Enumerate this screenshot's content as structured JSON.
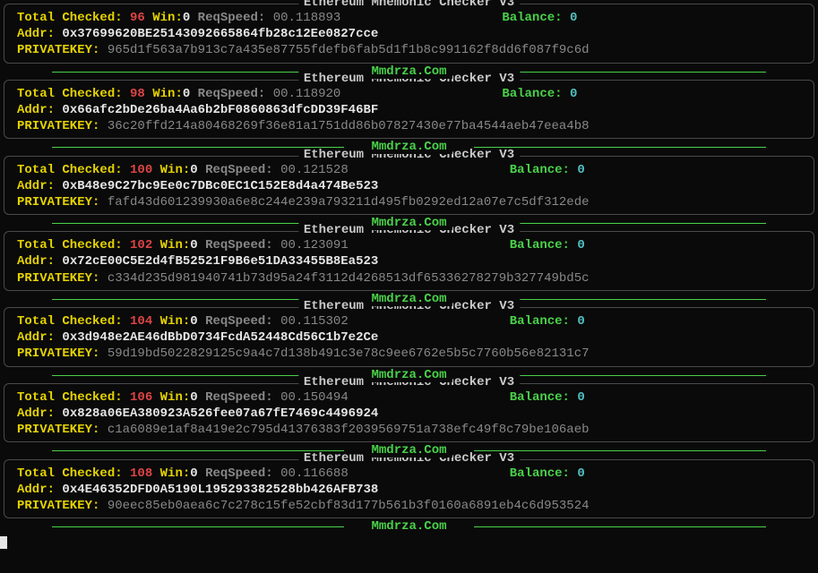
{
  "labels": {
    "title": "Ethereum Mnemonic Checker V3",
    "totalChecked": "Total Checked:",
    "win": "Win:",
    "reqSpeed": "ReqSpeed:",
    "balance": "Balance:",
    "addr": "Addr:",
    "privateKey": "PRIVATEKEY:",
    "footer": "Mmdrza.Com"
  },
  "entries": [
    {
      "totalChecked": "96",
      "win": "0",
      "reqSpeed": "00.118893",
      "balance": "0",
      "addr": "0x37699620BE25143092665864fb28c12Ee0827cce",
      "privateKey": "965d1f563a7b913c7a435e87755fdefb6fab5d1f1b8c991162f8dd6f087f9c6d"
    },
    {
      "totalChecked": "98",
      "win": "0",
      "reqSpeed": "00.118920",
      "balance": "0",
      "addr": "0x66afc2bDe26ba4Aa6b2bF0860863dfcDD39F46BF",
      "privateKey": "36c20ffd214a80468269f36e81a1751dd86b07827430e77ba4544aeb47eea4b8"
    },
    {
      "totalChecked": "100",
      "win": "0",
      "reqSpeed": "00.121528",
      "balance": "0",
      "addr": "0xB48e9C27bc9Ee0c7DBc0EC1C152E8d4a474Be523",
      "privateKey": "fafd43d601239930a6e8c244e239a793211d495fb0292ed12a07e7c5df312ede"
    },
    {
      "totalChecked": "102",
      "win": "0",
      "reqSpeed": "00.123091",
      "balance": "0",
      "addr": "0x72cE00C5E2d4fB52521F9B6e51DA33455B8Ea523",
      "privateKey": "c334d235d981940741b73d95a24f3112d4268513df65336278279b327749bd5c"
    },
    {
      "totalChecked": "104",
      "win": "0",
      "reqSpeed": "00.115302",
      "balance": "0",
      "addr": "0x3d948e2AE46dBbD0734FcdA52448Cd56C1b7e2Ce",
      "privateKey": "59d19bd5022829125c9a4c7d138b491c3e78c9ee6762e5b5c7760b56e82131c7"
    },
    {
      "totalChecked": "106",
      "win": "0",
      "reqSpeed": "00.150494",
      "balance": "0",
      "addr": "0x828a06EA380923A526fee07a67fE7469c4496924",
      "privateKey": "c1a6089e1af8a419e2c795d41376383f2039569751a738efc49f8c79be106aeb"
    },
    {
      "totalChecked": "108",
      "win": "0",
      "reqSpeed": "00.116688",
      "balance": "0",
      "addr": "0x4E46352DFD0A5190L195293382528bb426AFB738",
      "privateKey": "90eec85eb0aea6c7c278c15fe52cbf83d177b561b3f0160a6891eb4c6d953524"
    }
  ]
}
